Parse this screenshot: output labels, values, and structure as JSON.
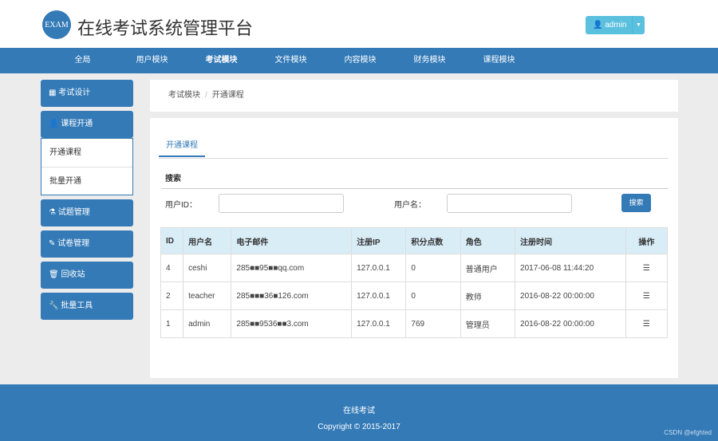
{
  "header": {
    "logo": "EXAM",
    "title": "在线考试系统管理平台",
    "user": "admin"
  },
  "nav": [
    "全局",
    "用户模块",
    "考试模块",
    "文件模块",
    "内容模块",
    "财务模块",
    "课程模块"
  ],
  "sidebar": {
    "items": [
      "考试设计",
      "课程开通",
      "试题管理",
      "试卷管理",
      "回收站",
      "批量工具"
    ],
    "sub": [
      "开通课程",
      "批量开通"
    ]
  },
  "breadcrumb": {
    "parent": "考试模块",
    "current": "开通课程"
  },
  "tab": "开通课程",
  "search": {
    "title": "搜索",
    "id_label": "用户ID：",
    "name_label": "用户名：",
    "button": "搜索",
    "id_value": "",
    "name_value": ""
  },
  "table": {
    "headers": [
      "ID",
      "用户名",
      "电子邮件",
      "注册IP",
      "积分点数",
      "角色",
      "注册时间",
      "操作"
    ],
    "rows": [
      [
        "4",
        "ceshi",
        "285■■95■■qq.com",
        "127.0.0.1",
        "0",
        "普通用户",
        "2017-06-08 11:44:20"
      ],
      [
        "2",
        "teacher",
        "285■■■36■126.com",
        "127.0.0.1",
        "0",
        "教师",
        "2016-08-22 00:00:00"
      ],
      [
        "1",
        "admin",
        "285■■9536■■3.com",
        "127.0.0.1",
        "769",
        "管理员",
        "2016-08-22 00:00:00"
      ]
    ]
  },
  "footer": {
    "line1": "在线考试",
    "line2": "Copyright © 2015-2017"
  },
  "watermark": "CSDN @efghted"
}
